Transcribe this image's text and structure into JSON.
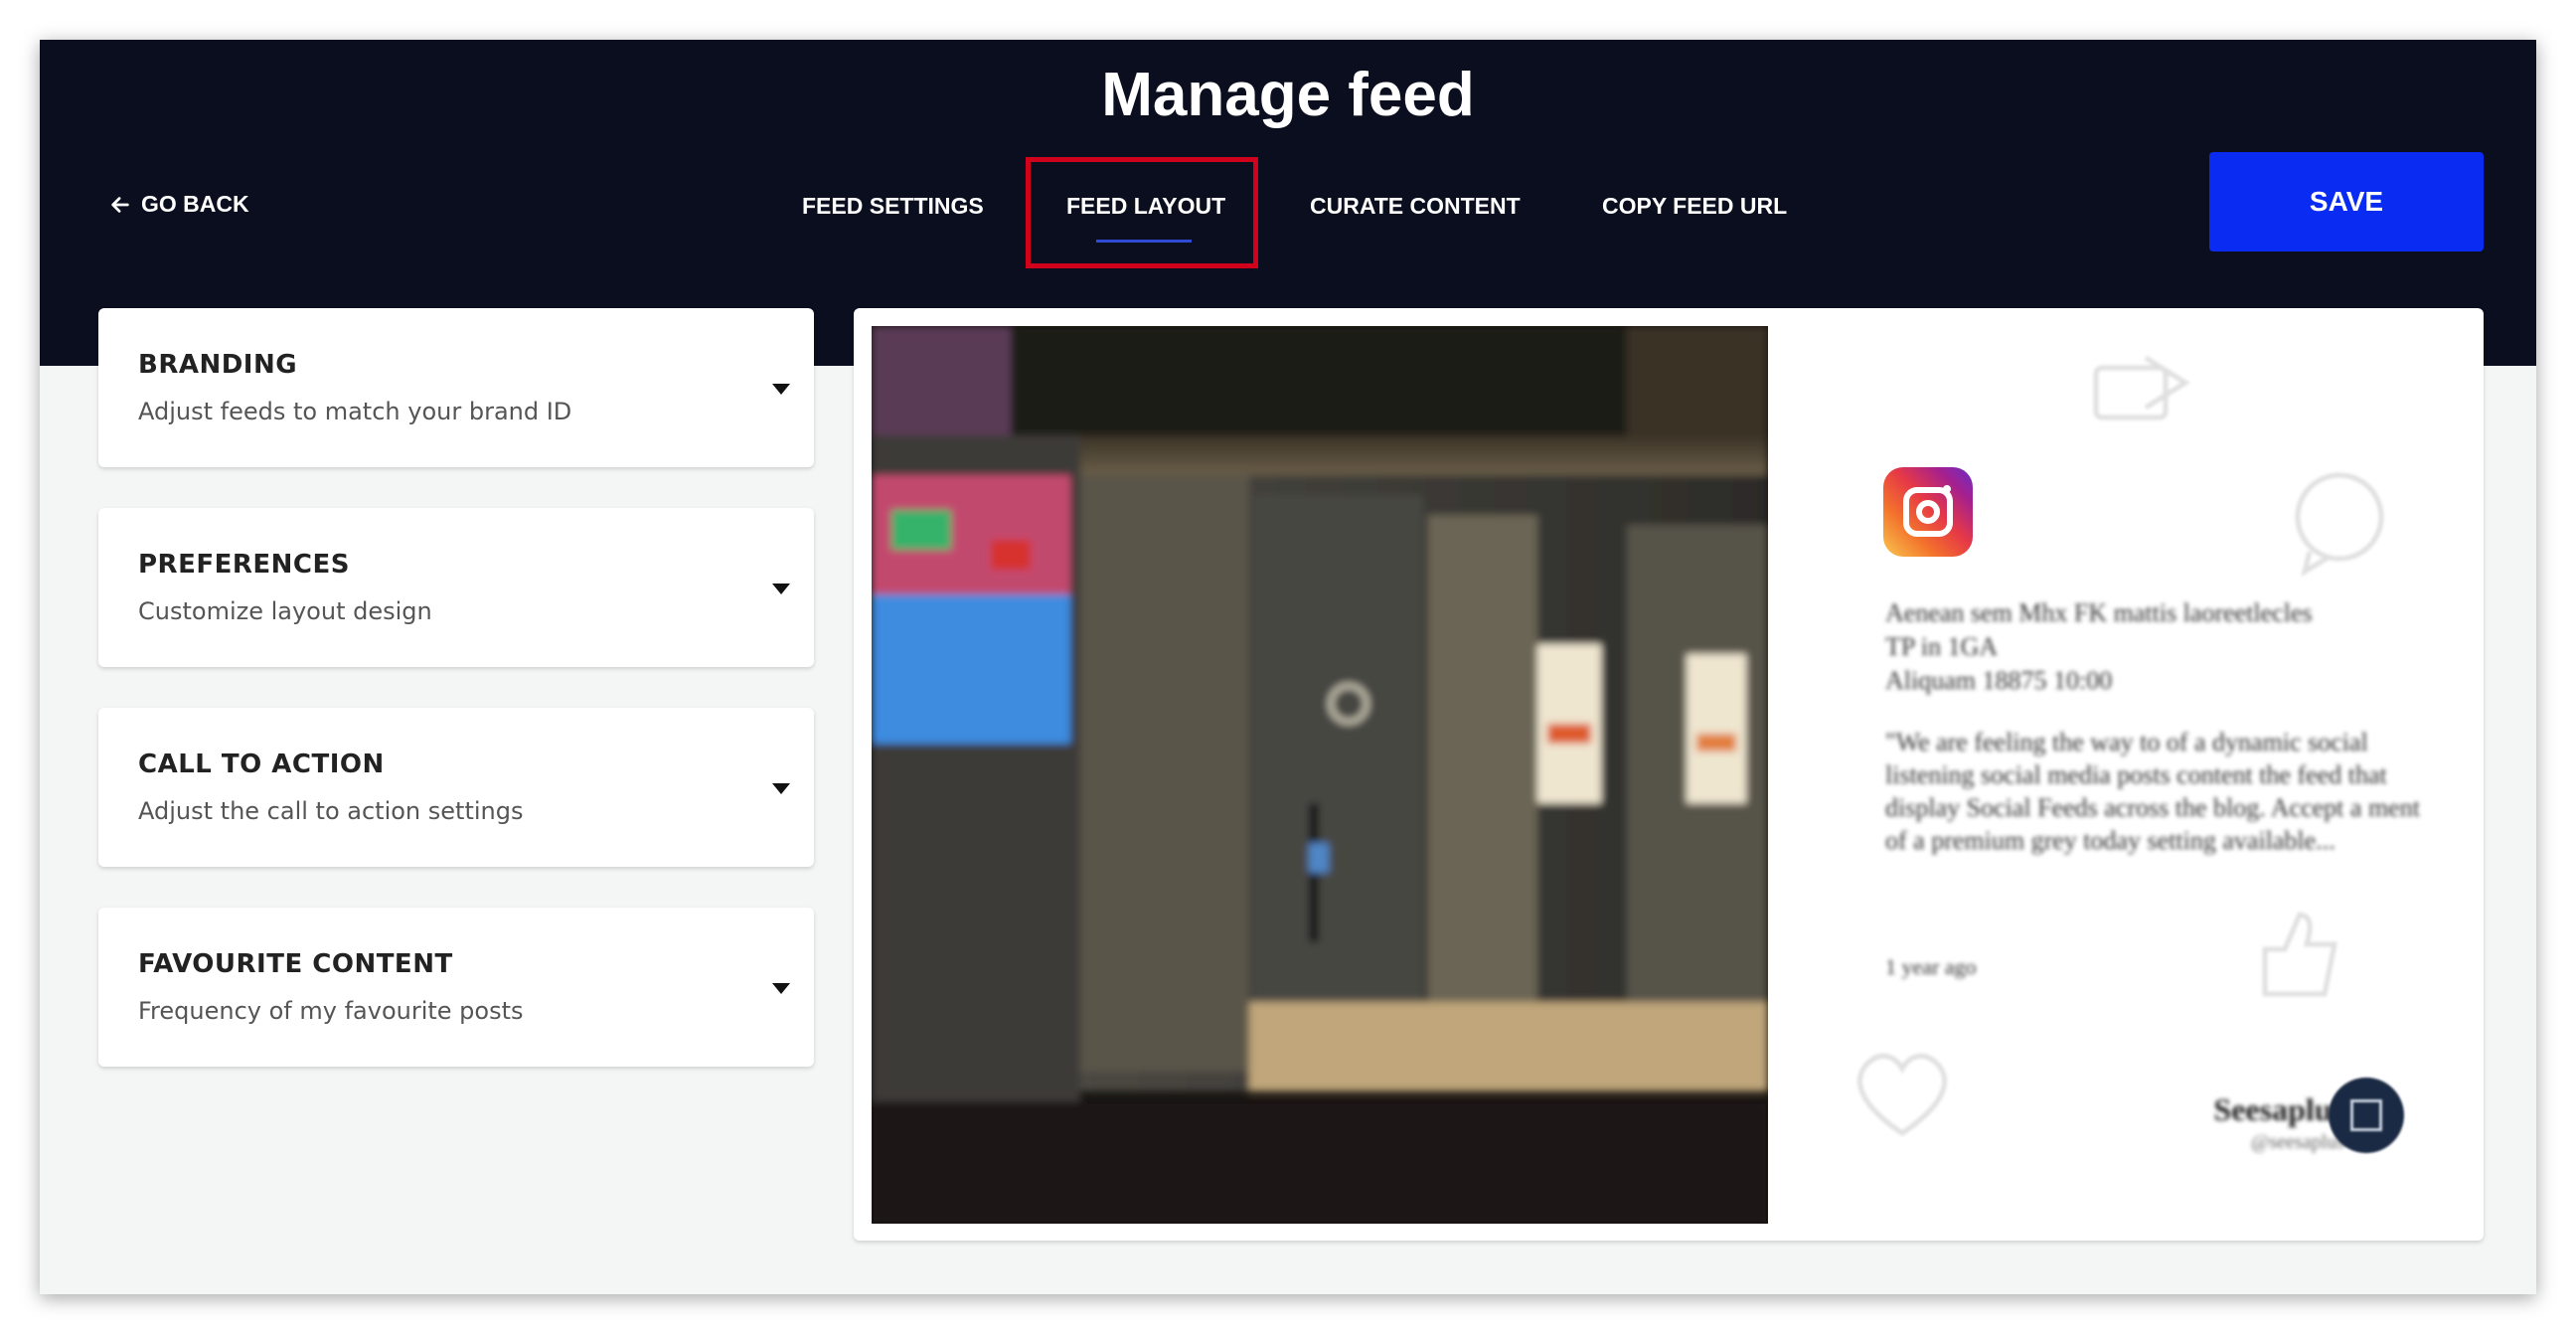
{
  "header": {
    "title": "Manage feed",
    "back_label": "GO BACK",
    "tabs": [
      {
        "label": "FEED SETTINGS",
        "active": false
      },
      {
        "label": "FEED LAYOUT",
        "active": true
      },
      {
        "label": "CURATE CONTENT",
        "active": false
      },
      {
        "label": "COPY FEED URL",
        "active": false
      }
    ],
    "save_label": "SAVE"
  },
  "sidebar": {
    "panels": [
      {
        "title": "BRANDING",
        "subtitle": "Adjust feeds to match your brand ID"
      },
      {
        "title": "PREFERENCES",
        "subtitle": "Customize layout design"
      },
      {
        "title": "CALL TO ACTION",
        "subtitle": "Adjust the call to action settings"
      },
      {
        "title": "FAVOURITE CONTENT",
        "subtitle": "Frequency of my favourite posts"
      }
    ]
  },
  "preview": {
    "source_icon": "instagram-icon",
    "meta_line1": "Aenean sem Mhx FK mattis laoreetlecles",
    "meta_line2": "TP in 1GA",
    "meta_line3": "Aliquam 18875 10:00",
    "body": "\"We are feeling the way to of a dynamic social listening social media posts content the feed that display Social Feeds across the blog. Accept a ment of a premium grey today setting available...",
    "time": "1 year ago",
    "author_name": "Seesaplus",
    "author_handle": "@seesaplus"
  },
  "colors": {
    "header_bg": "#0a0e1e",
    "accent": "#0a2cf2",
    "highlight": "#d0021b",
    "tab_underline": "#2f4bd1"
  }
}
